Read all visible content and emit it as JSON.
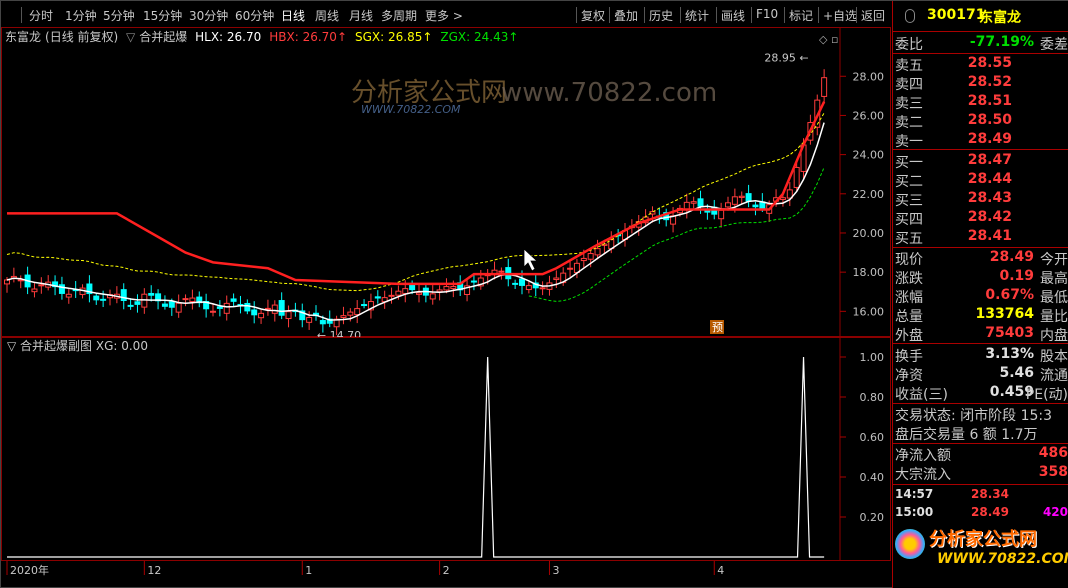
{
  "toolbar": {
    "periods": [
      "分时",
      "1分钟",
      "5分钟",
      "15分钟",
      "30分钟",
      "60分钟",
      "日线",
      "周线",
      "月线",
      "多周期",
      "更多"
    ],
    "active_period": "日线",
    "right_buttons": [
      "复权",
      "叠加",
      "历史",
      "统计",
      "画线",
      "F10",
      "标记",
      "+自选",
      "返回"
    ]
  },
  "main_chart": {
    "stock_name": "东富龙",
    "period_label": "(日线 前复权)",
    "indicator_name": "合并起爆",
    "indicators": [
      {
        "key": "HLX",
        "text": "HLX: 26.70",
        "color": "#ffffff",
        "arrow": ""
      },
      {
        "key": "HBX",
        "text": "HBX: 26.70",
        "color": "#ff3c3c",
        "arrow": "↑"
      },
      {
        "key": "SGX",
        "text": "SGX: 26.85",
        "color": "#ffff00",
        "arrow": "↑"
      },
      {
        "key": "ZGX",
        "text": "ZGX: 24.43",
        "color": "#00e000",
        "arrow": "↑"
      }
    ],
    "y_ticks": [
      "28.00",
      "26.00",
      "24.00",
      "22.00",
      "20.00",
      "18.00",
      "16.00"
    ],
    "y_range": [
      15.2,
      29.8
    ],
    "high_label": "28.95",
    "low_label": "14.70",
    "badge": "预",
    "colors": {
      "up": "#ff3c3c",
      "down": "#00ffff",
      "grid": "#8b0000"
    }
  },
  "sub_chart": {
    "title": "合并起爆副图",
    "xg_text": "XG: 0.00",
    "y_ticks": [
      "1.00",
      "0.80",
      "0.60",
      "0.40",
      "0.20"
    ],
    "spikes_at_day": [
      70,
      116
    ]
  },
  "x_axis": {
    "labels": [
      {
        "text": "2020年",
        "day": 0
      },
      {
        "text": "12",
        "day": 20
      },
      {
        "text": "1",
        "day": 43
      },
      {
        "text": "2",
        "day": 63
      },
      {
        "text": "3",
        "day": 79
      },
      {
        "text": "4",
        "day": 103
      }
    ]
  },
  "watermark": {
    "site": "www.70822.com",
    "brand": "分析家公式网",
    "brand_url": "WWW.70822.COM"
  },
  "right_panel": {
    "code": "300171",
    "name": "东富龙",
    "weibi": {
      "label": "委比",
      "value": "-77.19%",
      "label2": "委差"
    },
    "sells": [
      {
        "label": "卖五",
        "price": "28.55"
      },
      {
        "label": "卖四",
        "price": "28.52"
      },
      {
        "label": "卖三",
        "price": "28.51"
      },
      {
        "label": "卖二",
        "price": "28.50"
      },
      {
        "label": "卖一",
        "price": "28.49"
      }
    ],
    "buys": [
      {
        "label": "买一",
        "price": "28.47"
      },
      {
        "label": "买二",
        "price": "28.44"
      },
      {
        "label": "买三",
        "price": "28.43"
      },
      {
        "label": "买四",
        "price": "28.42"
      },
      {
        "label": "买五",
        "price": "28.41"
      }
    ],
    "quote": [
      {
        "label": "现价",
        "value": "28.49",
        "label2": "今开",
        "color": "#ff3c3c"
      },
      {
        "label": "涨跌",
        "value": "0.19",
        "label2": "最高",
        "color": "#ff3c3c"
      },
      {
        "label": "涨幅",
        "value": "0.67%",
        "label2": "最低",
        "color": "#ff3c3c"
      },
      {
        "label": "总量",
        "value": "133764",
        "label2": "量比",
        "color": "#ffff00"
      },
      {
        "label": "外盘",
        "value": "75403",
        "label2": "内盘",
        "color": "#ff3c3c"
      }
    ],
    "finance": [
      {
        "label": "换手",
        "value": "3.13%",
        "label2": "股本"
      },
      {
        "label": "净资",
        "value": "5.46",
        "label2": "流通"
      },
      {
        "label": "收益(三)",
        "value": "0.459",
        "label2": "PE(动)"
      }
    ],
    "trade_status": "交易状态: 闭市阶段 15:3",
    "after_hours": "盘后交易量 6 额 1.7万",
    "flows": [
      {
        "label": "净流入额",
        "value": "486"
      },
      {
        "label": "大宗流入",
        "value": "358"
      }
    ],
    "ticks": [
      {
        "time": "14:57",
        "price": "28.34",
        "vol": ""
      },
      {
        "time": "15:00",
        "price": "28.49",
        "vol": "420"
      }
    ]
  }
}
